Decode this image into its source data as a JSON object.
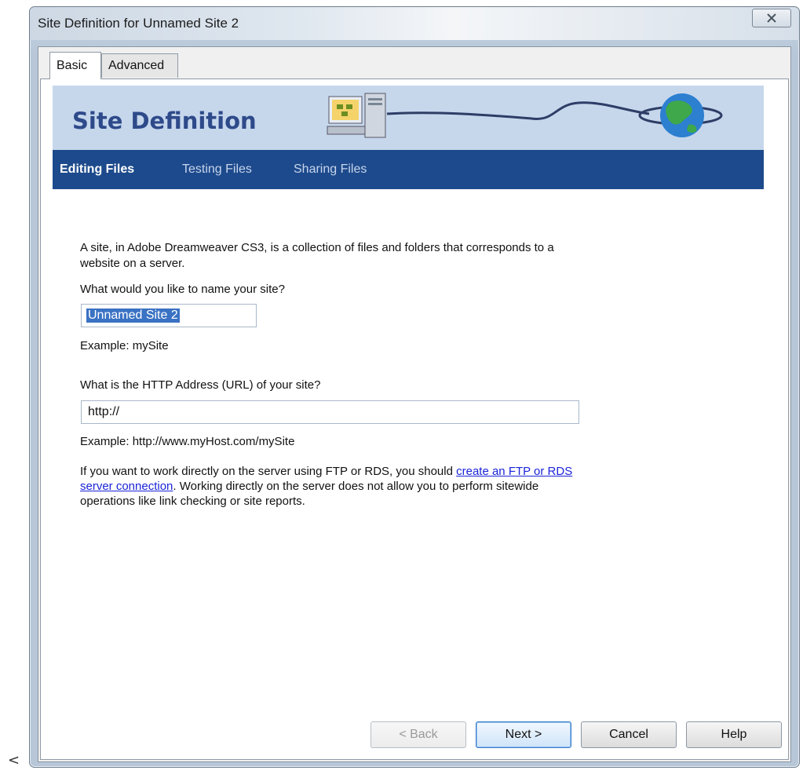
{
  "window": {
    "title": "Site Definition for Unnamed Site 2"
  },
  "stray_char": "<",
  "tabs": [
    {
      "label": "Basic"
    },
    {
      "label": "Advanced"
    }
  ],
  "banner": {
    "title": "Site Definition",
    "nav": [
      {
        "label": "Editing Files"
      },
      {
        "label": "Testing Files"
      },
      {
        "label": "Sharing Files"
      }
    ]
  },
  "content": {
    "intro_line1": "A site, in Adobe Dreamweaver CS3, is a collection of files and folders that corresponds to a",
    "intro_line2": "website on a server.",
    "name_question": "What would you like to name your site?",
    "name_value": "Unnamed Site 2",
    "name_example": "Example: mySite",
    "url_question": "What is the HTTP Address (URL) of your site?",
    "url_value": "http://",
    "url_example": "Example: http://www.myHost.com/mySite",
    "ftp_line1_pre": "If you want to work directly on the server using FTP or RDS, you should ",
    "ftp_link1": "create an FTP or RDS",
    "ftp_link2": "server connection",
    "ftp_line2_post": ".  Working directly on the server does not allow you to perform sitewide",
    "ftp_line3": "operations like link checking or site reports."
  },
  "buttons": {
    "back": "< Back",
    "next": "Next >",
    "cancel": "Cancel",
    "help": "Help"
  },
  "icons": {
    "close": "close-icon",
    "computer": "computer-icon",
    "globe": "globe-icon"
  }
}
